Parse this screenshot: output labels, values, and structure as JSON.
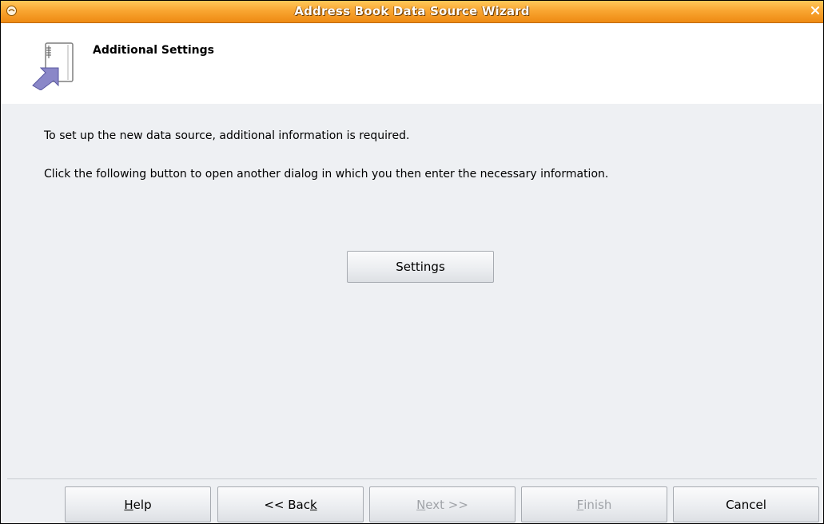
{
  "window": {
    "title": "Address Book Data Source Wizard"
  },
  "header": {
    "title": "Additional Settings",
    "icon": "address-book-wizard-icon"
  },
  "content": {
    "line1": "To set up the new data source, additional information is required.",
    "line2": "Click the following button to open another dialog in which you then enter the necessary information.",
    "settings_button": "Settings"
  },
  "footer": {
    "help": {
      "pre": "",
      "mnemonic": "H",
      "post": "elp",
      "enabled": true
    },
    "back": {
      "pre": "<< Bac",
      "mnemonic": "k",
      "post": "",
      "enabled": true
    },
    "next": {
      "pre": "",
      "mnemonic": "N",
      "post": "ext >>",
      "enabled": false
    },
    "finish": {
      "pre": "",
      "mnemonic": "F",
      "post": "inish",
      "enabled": false
    },
    "cancel": {
      "label": "Cancel",
      "enabled": true
    }
  },
  "colors": {
    "titlebar_top": "#ffc85a",
    "titlebar_bottom": "#ee8a12",
    "content_bg": "#eef0f3",
    "disabled_text": "#a0a3a8"
  }
}
